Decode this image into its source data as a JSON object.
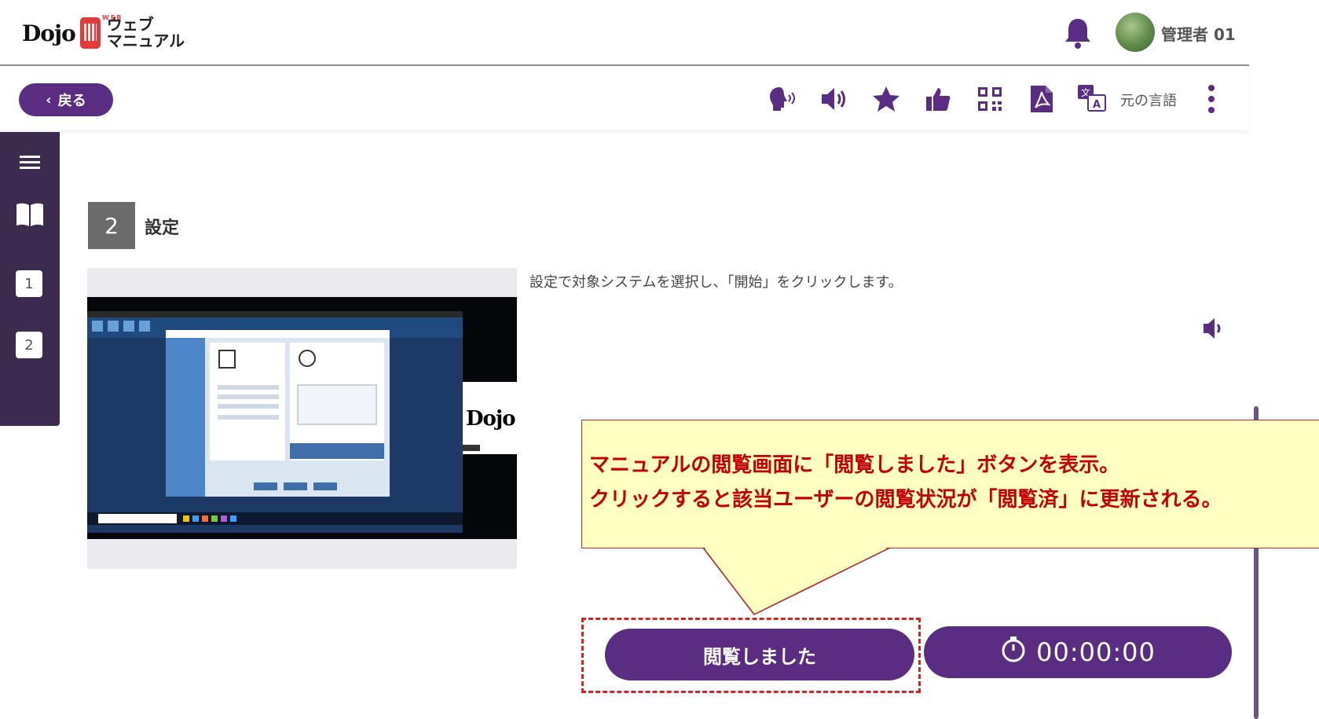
{
  "header": {
    "logo_brand": "Dojo",
    "logo_web": "WEB",
    "logo_line1": "ウェブ",
    "logo_line2": "マニュアル",
    "user_name": "管理者 01",
    "icons": [
      "bell-icon",
      "avatar"
    ]
  },
  "toolbar": {
    "back_label": "戻る",
    "icons": [
      "voice-read-icon",
      "speaker-icon",
      "star-icon",
      "thumbs-up-icon",
      "qr-code-icon",
      "pdf-icon",
      "translate-icon",
      "more-vertical-icon"
    ],
    "language_label": "元の言語"
  },
  "sidebar": {
    "icons": [
      "menu-icon",
      "book-icon"
    ],
    "steps": [
      "1",
      "2"
    ]
  },
  "step": {
    "number": "2",
    "title": "設定",
    "description": "設定で対象システムを選択し、「開始」をクリックします。"
  },
  "video": {
    "watermark": "Dojo"
  },
  "callout": {
    "line1": "マニュアルの閲覧画面に「閲覧しました」ボタンを表示。",
    "line2": "クリックすると該当ユーザーの閲覧状況が「閲覧済」に更新される。"
  },
  "actions": {
    "read_button": "閲覧しました",
    "timer": "00:00:00"
  },
  "colors": {
    "accent": "#5a2d82",
    "sidebar": "#3c2b4f",
    "callout_bg": "#ffffc2",
    "callout_text": "#c40000"
  }
}
